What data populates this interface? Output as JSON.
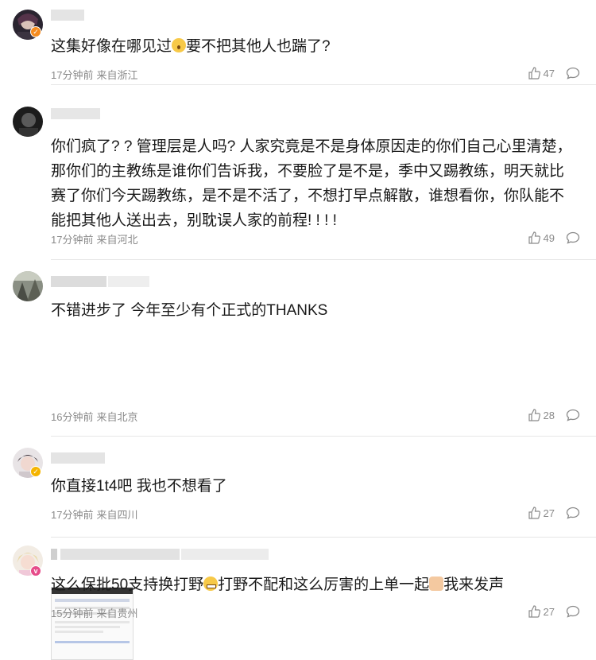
{
  "comments": [
    {
      "text": "这集好像在哪见过",
      "text_after": "要不把其他人也踹了?",
      "time": "17分钟前",
      "location": "来自浙江",
      "likes": "47"
    },
    {
      "text": "你们疯了? ? 管理层是人吗? 人家究竟是不是身体原因走的你们自己心里清楚，那你们的主教练是谁你们告诉我，不要脸了是不是，季中又踢教练，明天就比赛了你们今天踢教练，是不是不活了，不想打早点解散，谁想看你，你队能不能把其他人送出去，别耽误人家的前程! ! ! !",
      "time": "17分钟前",
      "location": "来自河北",
      "likes": "49"
    },
    {
      "text": "不错进步了 今年至少有个正式的THANKS",
      "time": "16分钟前",
      "location": "来自北京",
      "likes": "28"
    },
    {
      "text": "你直接1t4吧 我也不想看了",
      "time": "17分钟前",
      "location": "来自四川",
      "likes": "27"
    },
    {
      "text": "这么保批50支持换打野",
      "text_mid": "打野不配和这么厉害的上单一起",
      "text_after": "我来发声",
      "time": "15分钟前",
      "location": "来自贵州",
      "likes": "27"
    }
  ],
  "icons": {
    "like": "thumbs-up-icon",
    "reply": "comment-bubble-icon",
    "verified": "verified-badge-icon"
  },
  "colors": {
    "verified_orange": "#f58b1f",
    "verified_gold": "#f5b400",
    "verified_pink": "#e64c8a",
    "meta": "#8a8a8a"
  }
}
